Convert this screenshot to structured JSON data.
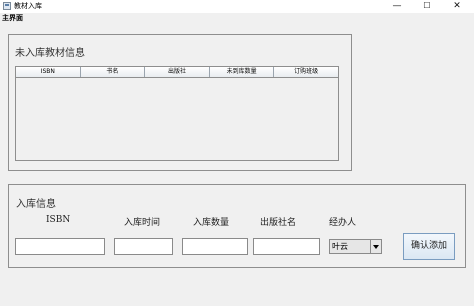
{
  "window": {
    "title": "教材入库",
    "minimize": "—",
    "maximize": "☐",
    "close": "✕"
  },
  "menubar": {
    "item": "主界面"
  },
  "pending_panel": {
    "title": "未入库教材信息",
    "columns": [
      "ISBN",
      "书名",
      "出版社",
      "未到库数量",
      "订购班级"
    ]
  },
  "stock_panel": {
    "title": "入库信息",
    "labels": {
      "isbn": "ISBN",
      "time": "入库时间",
      "quantity": "入库数量",
      "publisher": "出版社名",
      "handler": "经办人"
    },
    "fields": {
      "isbn": "",
      "time": "",
      "quantity": "",
      "publisher": ""
    },
    "handler_selected": "叶云",
    "confirm_label": "确认添加"
  }
}
